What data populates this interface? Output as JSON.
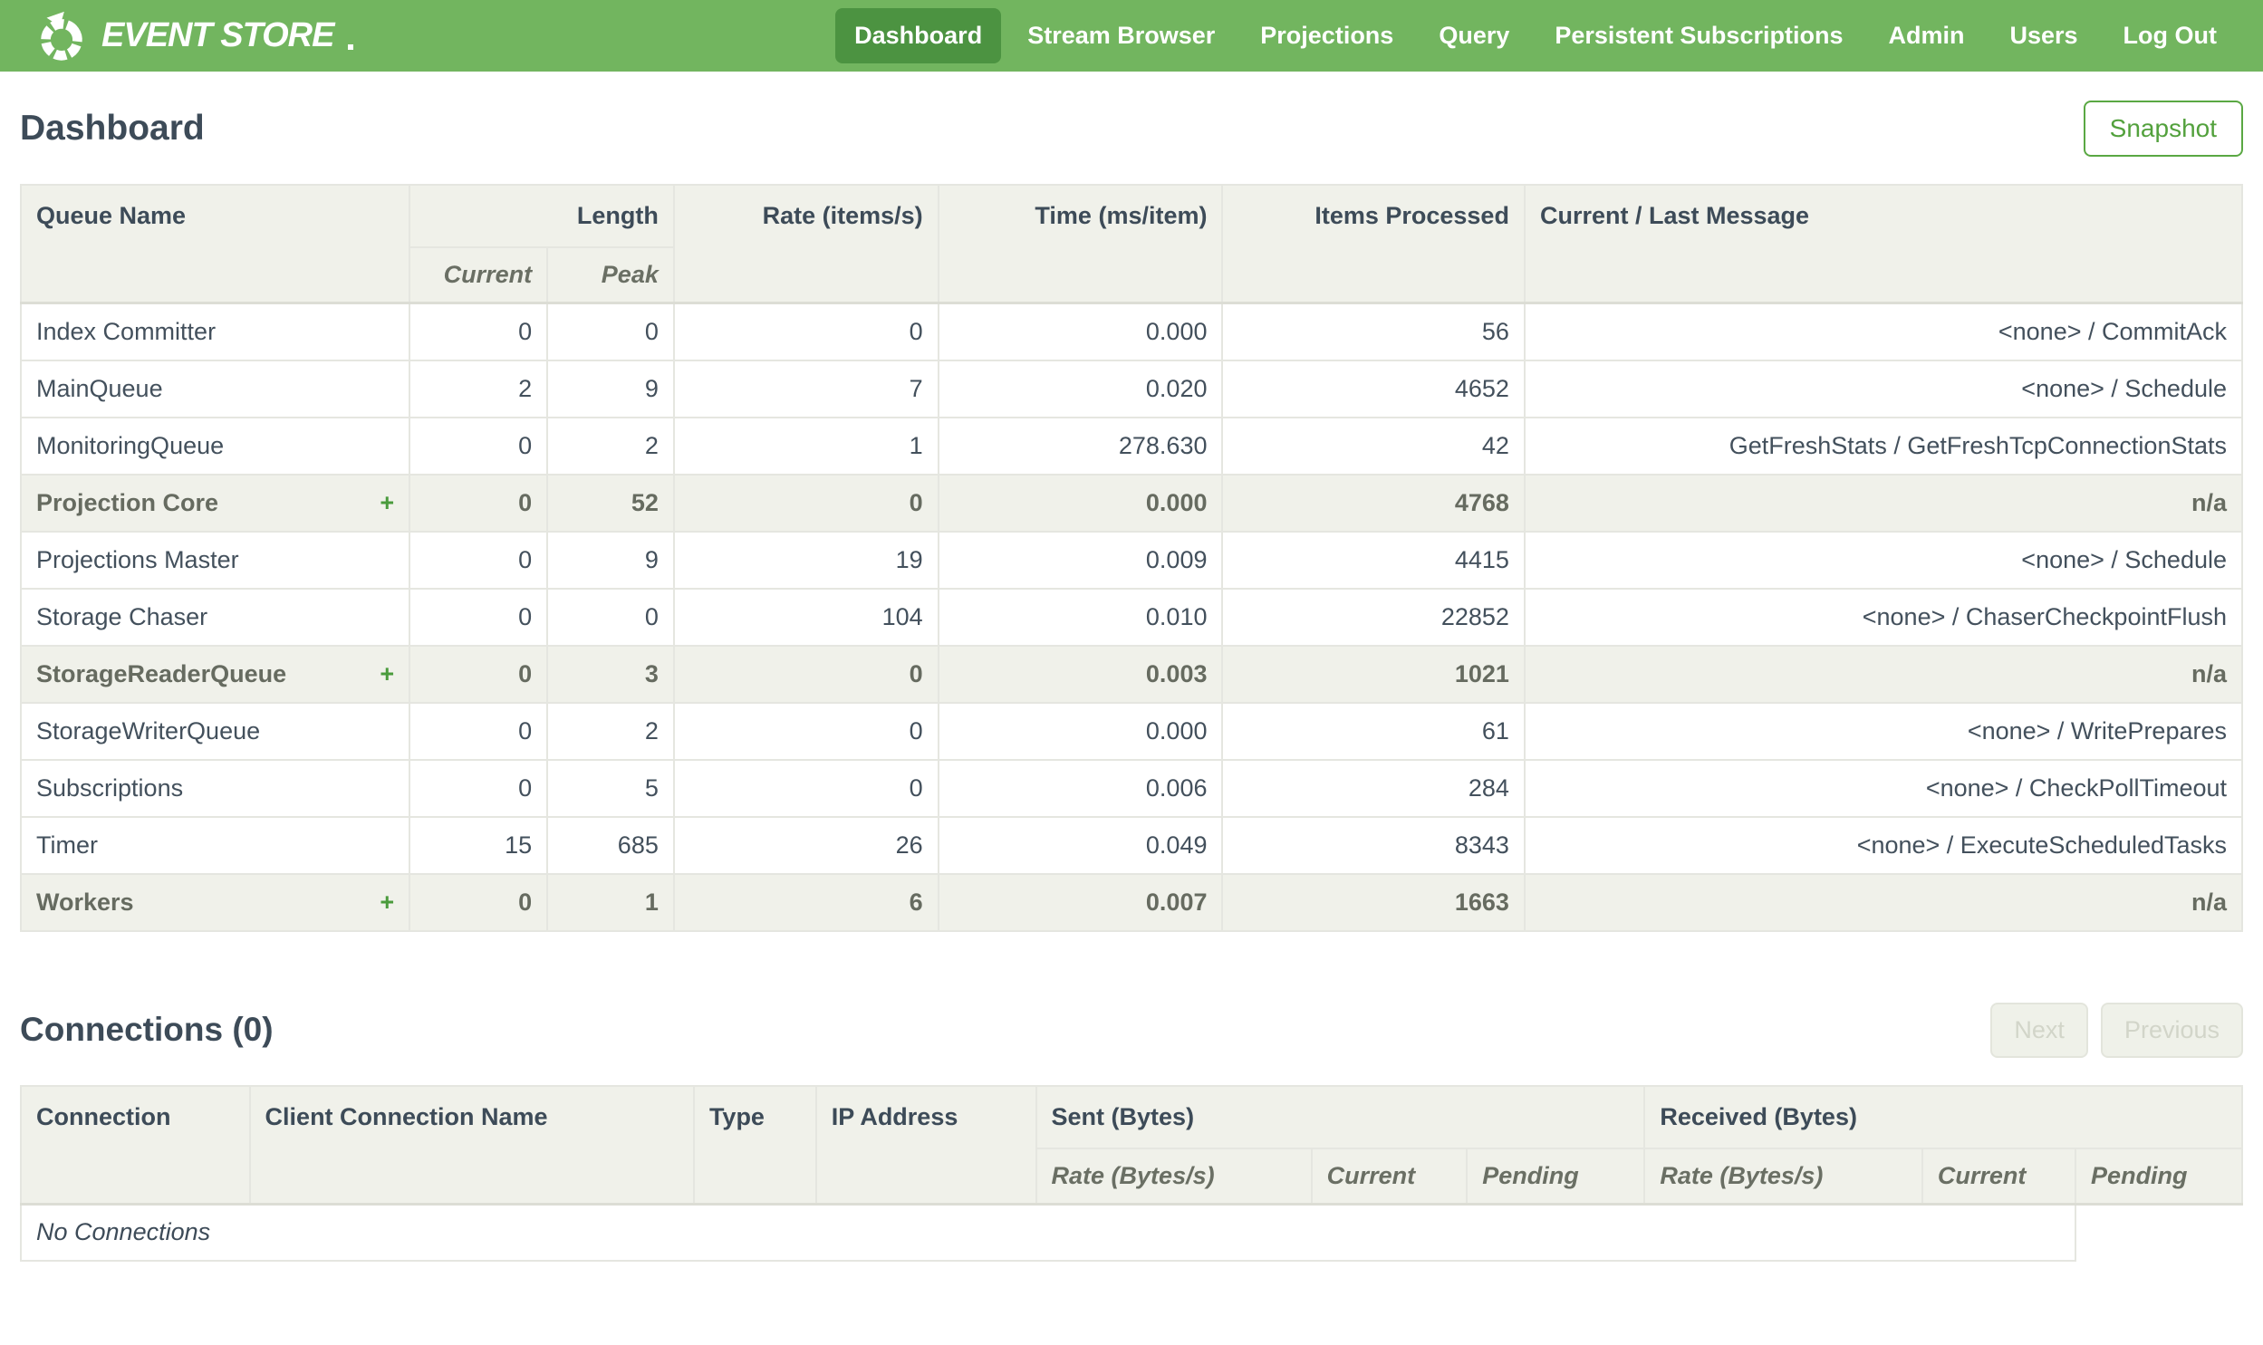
{
  "nav": {
    "brand": "EVENT STORE",
    "items": [
      {
        "label": "Dashboard",
        "active": true
      },
      {
        "label": "Stream Browser",
        "active": false
      },
      {
        "label": "Projections",
        "active": false
      },
      {
        "label": "Query",
        "active": false
      },
      {
        "label": "Persistent Subscriptions",
        "active": false
      },
      {
        "label": "Admin",
        "active": false
      },
      {
        "label": "Users",
        "active": false
      },
      {
        "label": "Log Out",
        "active": false
      }
    ]
  },
  "page": {
    "title": "Dashboard",
    "snapshot_label": "Snapshot"
  },
  "queues": {
    "headers": {
      "queue_name": "Queue Name",
      "length": "Length",
      "current": "Current",
      "peak": "Peak",
      "rate": "Rate (items/s)",
      "time": "Time (ms/item)",
      "items_processed": "Items Processed",
      "message": "Current / Last Message"
    },
    "expand_glyph": "+",
    "rows": [
      {
        "name": "Index Committer",
        "group": false,
        "current": "0",
        "peak": "0",
        "rate": "0",
        "time": "0.000",
        "items": "56",
        "message": "<none> / CommitAck"
      },
      {
        "name": "MainQueue",
        "group": false,
        "current": "2",
        "peak": "9",
        "rate": "7",
        "time": "0.020",
        "items": "4652",
        "message": "<none> / Schedule"
      },
      {
        "name": "MonitoringQueue",
        "group": false,
        "current": "0",
        "peak": "2",
        "rate": "1",
        "time": "278.630",
        "items": "42",
        "message": "GetFreshStats / GetFreshTcpConnectionStats"
      },
      {
        "name": "Projection Core",
        "group": true,
        "current": "0",
        "peak": "52",
        "rate": "0",
        "time": "0.000",
        "items": "4768",
        "message": "n/a"
      },
      {
        "name": "Projections Master",
        "group": false,
        "current": "0",
        "peak": "9",
        "rate": "19",
        "time": "0.009",
        "items": "4415",
        "message": "<none> / Schedule"
      },
      {
        "name": "Storage Chaser",
        "group": false,
        "current": "0",
        "peak": "0",
        "rate": "104",
        "time": "0.010",
        "items": "22852",
        "message": "<none> / ChaserCheckpointFlush"
      },
      {
        "name": "StorageReaderQueue",
        "group": true,
        "current": "0",
        "peak": "3",
        "rate": "0",
        "time": "0.003",
        "items": "1021",
        "message": "n/a"
      },
      {
        "name": "StorageWriterQueue",
        "group": false,
        "current": "0",
        "peak": "2",
        "rate": "0",
        "time": "0.000",
        "items": "61",
        "message": "<none> / WritePrepares"
      },
      {
        "name": "Subscriptions",
        "group": false,
        "current": "0",
        "peak": "5",
        "rate": "0",
        "time": "0.006",
        "items": "284",
        "message": "<none> / CheckPollTimeout"
      },
      {
        "name": "Timer",
        "group": false,
        "current": "15",
        "peak": "685",
        "rate": "26",
        "time": "0.049",
        "items": "8343",
        "message": "<none> / ExecuteScheduledTasks"
      },
      {
        "name": "Workers",
        "group": true,
        "current": "0",
        "peak": "1",
        "rate": "6",
        "time": "0.007",
        "items": "1663",
        "message": "n/a"
      }
    ]
  },
  "connections": {
    "title": "Connections (0)",
    "next_label": "Next",
    "previous_label": "Previous",
    "headers": {
      "connection": "Connection",
      "client_name": "Client Connection Name",
      "type": "Type",
      "ip": "IP Address",
      "sent": "Sent (Bytes)",
      "received": "Received (Bytes)",
      "rate": "Rate (Bytes/s)",
      "current": "Current",
      "pending": "Pending"
    },
    "empty_text": "No Connections"
  },
  "colors": {
    "nav_green": "#72b55f",
    "active_nav_green": "#4c9341",
    "button_green": "#53a13d",
    "heading_slate": "#3d4b58",
    "header_bg": "#f0f1ea",
    "plus_green": "#4a9b3c"
  }
}
